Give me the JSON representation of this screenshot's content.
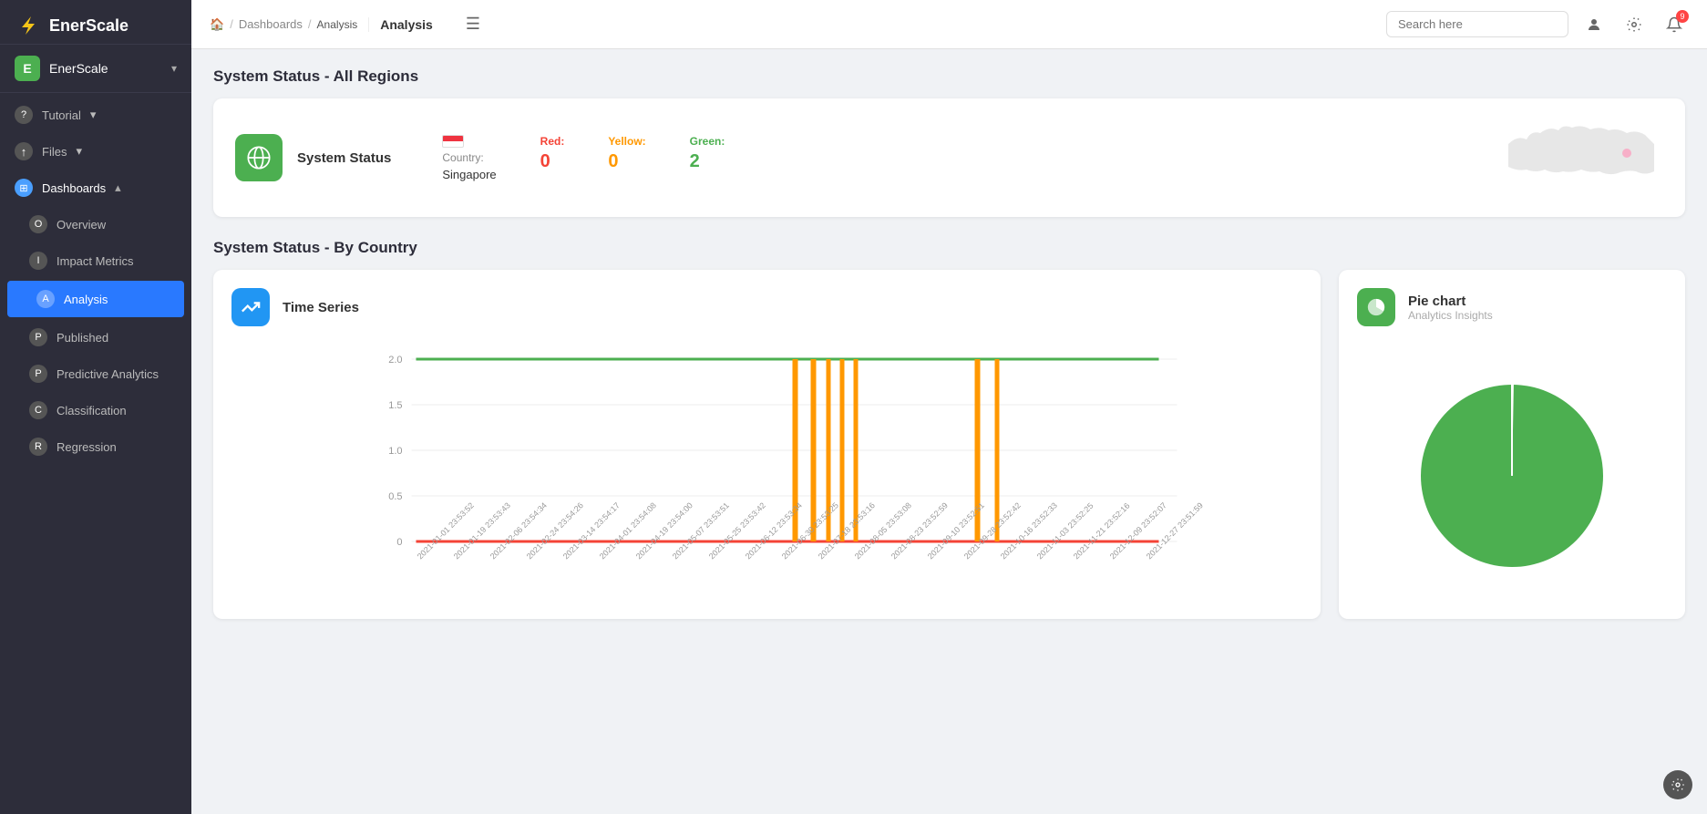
{
  "app": {
    "name": "EnerScale",
    "logo_letters": "E"
  },
  "sidebar": {
    "app_label": "EnerScale",
    "items": [
      {
        "id": "tutorial",
        "letter": "?",
        "label": "Tutorial",
        "has_chevron": true,
        "active": false
      },
      {
        "id": "files",
        "letter": "↑",
        "label": "Files",
        "has_chevron": true,
        "active": false
      },
      {
        "id": "dashboards",
        "letter": "⊞",
        "label": "Dashboards",
        "has_chevron": true,
        "active": false,
        "is_parent": true
      },
      {
        "id": "overview",
        "letter": "O",
        "label": "Overview",
        "active": false,
        "indent": true
      },
      {
        "id": "impact-metrics",
        "letter": "I",
        "label": "Impact Metrics",
        "active": false,
        "indent": true
      },
      {
        "id": "analysis",
        "letter": "A",
        "label": "Analysis",
        "active": true,
        "indent": true
      },
      {
        "id": "published",
        "letter": "P",
        "label": "Published",
        "active": false,
        "indent": true
      },
      {
        "id": "predictive-analytics",
        "letter": "P",
        "label": "Predictive Analytics",
        "active": false,
        "indent": true
      },
      {
        "id": "classification",
        "letter": "C",
        "label": "Classification",
        "active": false,
        "indent": true
      },
      {
        "id": "regression",
        "letter": "R",
        "label": "Regression",
        "active": false,
        "indent": true
      }
    ]
  },
  "topbar": {
    "breadcrumb_home": "🏠",
    "breadcrumb_dashboards": "Dashboards",
    "breadcrumb_current": "Analysis",
    "page_title": "Analysis",
    "search_placeholder": "Search here",
    "notification_count": "9",
    "hamburger": "☰"
  },
  "system_status_all": {
    "section_title": "System Status - All Regions",
    "card": {
      "icon": "🌐",
      "label": "System Status",
      "country_label": "Country:",
      "country_name": "Singapore",
      "red_label": "Red:",
      "red_value": "0",
      "yellow_label": "Yellow:",
      "yellow_value": "0",
      "green_label": "Green:",
      "green_value": "2"
    }
  },
  "system_status_country": {
    "section_title": "System Status - By Country",
    "time_series": {
      "icon": "📈",
      "title": "Time Series",
      "subtitle": "",
      "y_labels": [
        "2.0",
        "1.5",
        "1.0",
        "0.5",
        "0"
      ],
      "x_labels": [
        "2021-01-01 23:53:52",
        "2021-01-19 23:53:43",
        "2021-02-06 23:54:34",
        "2021-02-24 23:54:26",
        "2021-03-14 23:54:17",
        "2021-04-01 23:54:08",
        "2021-04-19 23:54:00",
        "2021-05-07 23:53:51",
        "2021-05-25 23:53:42",
        "2021-06-12 23:53:34",
        "2021-06-30 23:53:25",
        "2021-07-18 23:53:16",
        "2021-08-05 23:53:08",
        "2021-08-23 23:52:59",
        "2021-09-10 23:52:51",
        "2021-09-28 23:52:42",
        "2021-10-16 23:52:33",
        "2021-11-03 23:52:25",
        "2021-11-21 23:52:16",
        "2021-12-09 23:52:07",
        "2021-12-27 23:51:59"
      ]
    },
    "pie_chart": {
      "icon": "◑",
      "title": "Pie chart",
      "subtitle": "Analytics Insights"
    }
  },
  "settings": {
    "icon": "⚙"
  }
}
